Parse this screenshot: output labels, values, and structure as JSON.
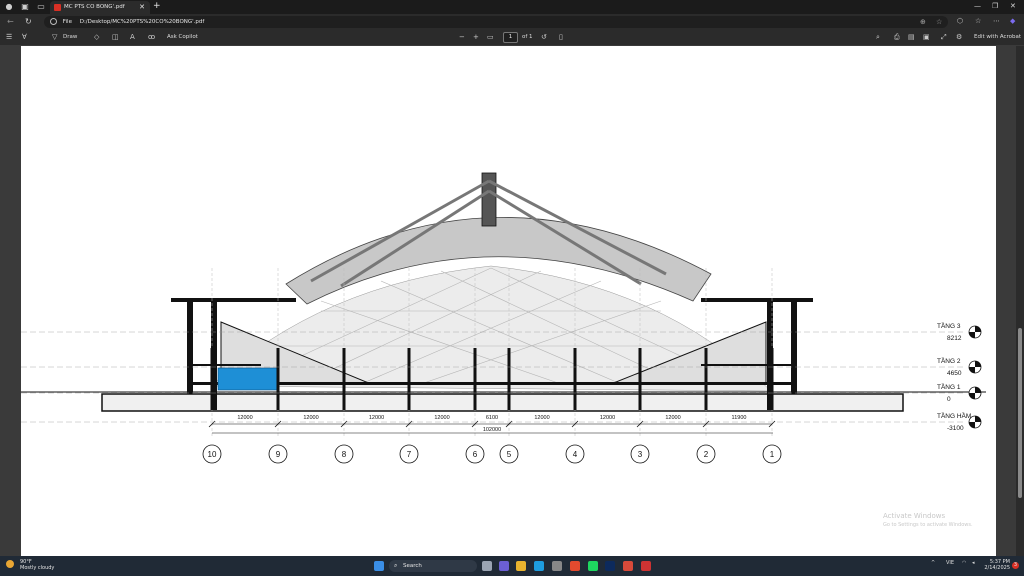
{
  "browser": {
    "tab_title": "MC PTS CO BONG'.pdf",
    "address_prefix": "File",
    "url": "D:/Desktop/MC%20PTS%20CO%20BONG'.pdf"
  },
  "pdf_toolbar": {
    "draw_label": "Draw",
    "ask_copilot_label": "Ask Copilot",
    "page_current": "1",
    "page_total": "of 1",
    "edit_acrobat_label": "Edit with Acrobat"
  },
  "drawing": {
    "axes": [
      "10",
      "9",
      "8",
      "7",
      "6",
      "5",
      "4",
      "3",
      "2",
      "1"
    ],
    "spans": [
      "12000",
      "12000",
      "12000",
      "12000",
      "6100",
      "12000",
      "12000",
      "12000",
      "11900"
    ],
    "total_span": "102000",
    "levels": [
      {
        "name": "TẦNG 3",
        "elevation": "8212"
      },
      {
        "name": "TẦNG 2",
        "elevation": "4650"
      },
      {
        "name": "TẦNG 1",
        "elevation": "0"
      },
      {
        "name": "TẦNG HẦM",
        "elevation": "-3100"
      }
    ],
    "colors": {
      "line": "#111111",
      "roof": "#c8c8c8",
      "glass": "#1e8fd6"
    }
  },
  "watermark": {
    "title": "Activate Windows",
    "subtitle": "Go to Settings to activate Windows."
  },
  "taskbar": {
    "temperature": "90°F",
    "condition": "Mostly cloudy",
    "search_placeholder": "Search",
    "lang": "VIE",
    "time": "5:37 PM",
    "date": "2/14/2025",
    "notifications": "3"
  }
}
